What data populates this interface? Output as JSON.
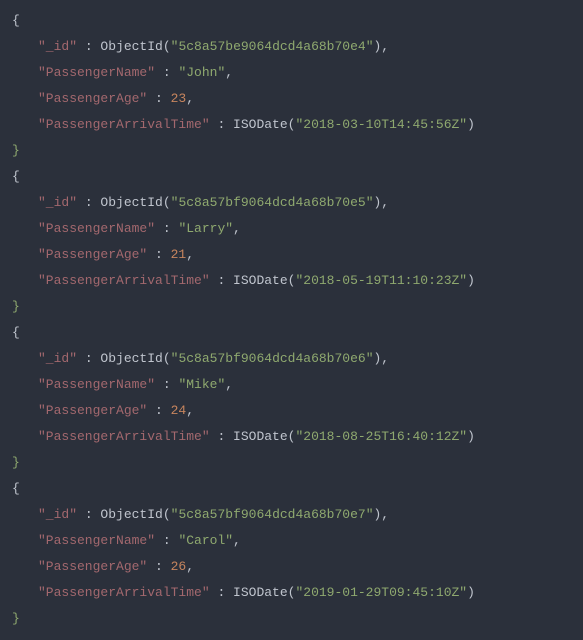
{
  "records": [
    {
      "id": "5c8a57be9064dcd4a68b70e4",
      "name": "John",
      "age": 23,
      "arrival": "2018-03-10T14:45:56Z"
    },
    {
      "id": "5c8a57bf9064dcd4a68b70e5",
      "name": "Larry",
      "age": 21,
      "arrival": "2018-05-19T11:10:23Z"
    },
    {
      "id": "5c8a57bf9064dcd4a68b70e6",
      "name": "Mike",
      "age": 24,
      "arrival": "2018-08-25T16:40:12Z"
    },
    {
      "id": "5c8a57bf9064dcd4a68b70e7",
      "name": "Carol",
      "age": 26,
      "arrival": "2019-01-29T09:45:10Z"
    }
  ],
  "keys": {
    "id": "\"_id\"",
    "name": "\"PassengerName\"",
    "age": "\"PassengerAge\"",
    "arrival": "\"PassengerArrivalTime\""
  },
  "funcs": {
    "objectid": "ObjectId",
    "isodate": "ISODate"
  }
}
